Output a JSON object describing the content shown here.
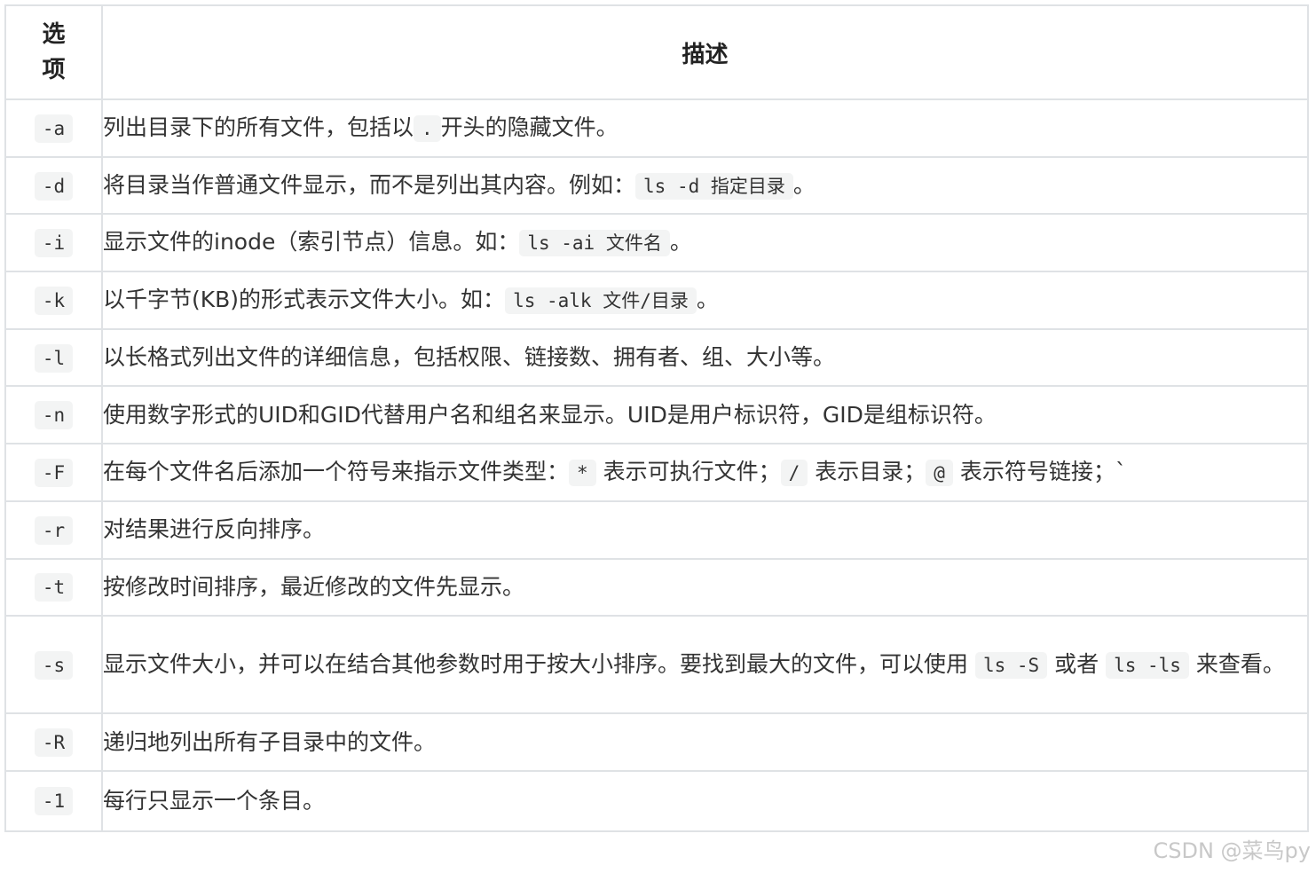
{
  "table": {
    "header": {
      "option_chars": [
        "选",
        "项"
      ],
      "description": "描述"
    },
    "rows": [
      {
        "option": "-a",
        "desc": [
          {
            "t": "列出目录下的所有文件，包括以"
          },
          {
            "c": "."
          },
          {
            "t": "开头的隐藏文件。"
          }
        ]
      },
      {
        "option": "-d",
        "desc": [
          {
            "t": "将目录当作普通文件显示，而不是列出其内容。例如："
          },
          {
            "c": "ls -d 指定目录"
          },
          {
            "t": "。"
          }
        ]
      },
      {
        "option": "-i",
        "desc": [
          {
            "t": "显示文件的inode（索引节点）信息。如："
          },
          {
            "c": "ls -ai 文件名"
          },
          {
            "t": "。"
          }
        ]
      },
      {
        "option": "-k",
        "desc": [
          {
            "t": "以千字节(KB)的形式表示文件大小。如："
          },
          {
            "c": "ls -alk 文件/目录"
          },
          {
            "t": "。"
          }
        ]
      },
      {
        "option": "-l",
        "desc": [
          {
            "t": "以长格式列出文件的详细信息，包括权限、链接数、拥有者、组、大小等。"
          }
        ]
      },
      {
        "option": "-n",
        "desc": [
          {
            "t": "使用数字形式的UID和GID代替用户名和组名来显示。UID是用户标识符，GID是组标识符。"
          }
        ]
      },
      {
        "option": "-F",
        "desc": [
          {
            "t": "在每个文件名后添加一个符号来指示文件类型："
          },
          {
            "c": "*"
          },
          {
            "t": " 表示可执行文件；"
          },
          {
            "c": "/"
          },
          {
            "t": " 表示目录；"
          },
          {
            "c": "@"
          },
          {
            "t": " 表示符号链接；`"
          }
        ]
      },
      {
        "option": "-r",
        "desc": [
          {
            "t": "对结果进行反向排序。"
          }
        ]
      },
      {
        "option": "-t",
        "desc": [
          {
            "t": "按修改时间排序，最近修改的文件先显示。"
          }
        ]
      },
      {
        "option": "-s",
        "tall": true,
        "desc": [
          {
            "t": "显示文件大小，并可以在结合其他参数时用于按大小排序。要找到最大的文件，可以使用 "
          },
          {
            "c": "ls -S"
          },
          {
            "t": " 或者 "
          },
          {
            "c": "ls -ls"
          },
          {
            "t": " 来查看。"
          }
        ]
      },
      {
        "option": "-R",
        "desc": [
          {
            "t": "递归地列出所有子目录中的文件。"
          }
        ]
      },
      {
        "option": "-1",
        "last": true,
        "desc": [
          {
            "t": "每行只显示一个条目。"
          }
        ]
      }
    ]
  },
  "watermark": "CSDN @菜鸟py"
}
